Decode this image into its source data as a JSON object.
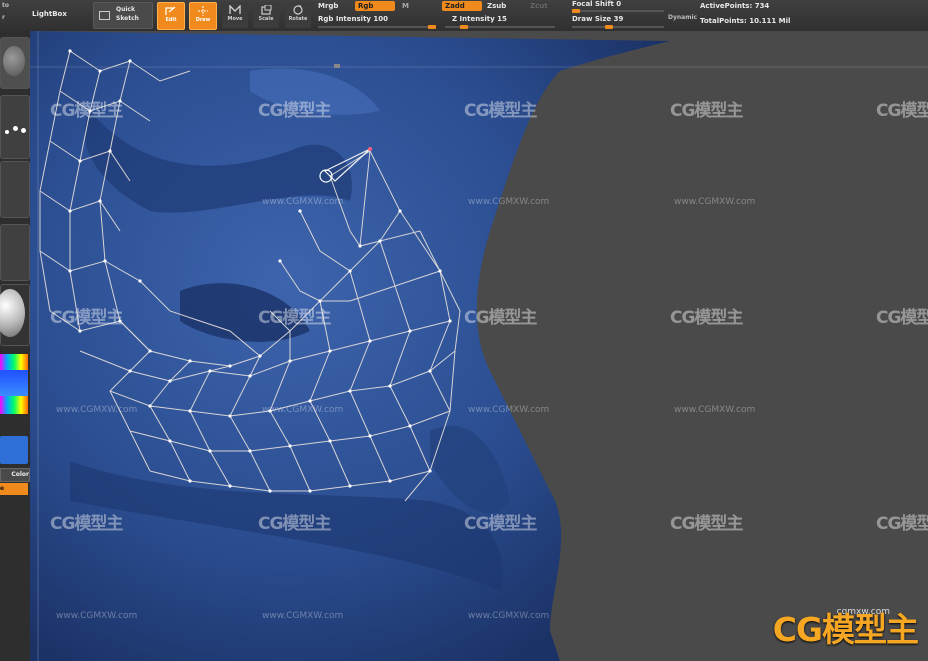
{
  "toolbar": {
    "lightbox": "LightBox",
    "quick_sketch": [
      "Quick",
      "Sketch"
    ],
    "modes": [
      {
        "label": "Edit",
        "icon": "edit-icon",
        "active": true
      },
      {
        "label": "Draw",
        "icon": "draw-icon",
        "active": true
      },
      {
        "label": "Move",
        "icon": "move-icon",
        "active": false
      },
      {
        "label": "Scale",
        "icon": "scale-icon",
        "active": false
      },
      {
        "label": "Rotate",
        "icon": "rotate-icon",
        "active": false
      }
    ],
    "mrgb": "Mrgb",
    "rgb": "Rgb",
    "m": "M",
    "rgb_intensity": "Rgb Intensity 100",
    "zadd": "Zadd",
    "zsub": "Zsub",
    "zcut": "Zcut",
    "z_intensity": "Z Intensity 15",
    "focal_shift": "Focal Shift 0",
    "draw_size": "Draw Size 39",
    "dynamic": "Dynamic",
    "active_points": "ActivePoints: 734",
    "total_points": "TotalPoints: 10.111 Mil",
    "slider_rgb_intensity": 1.0,
    "slider_z_intensity": 0.15,
    "slider_focal_shift": 0.0,
    "slider_draw_size": 0.39
  },
  "left_panel": {
    "labels": [
      "Color",
      "e"
    ]
  },
  "watermark": {
    "text": "CG模型主",
    "url": "www.CGMXW.com"
  },
  "logo": {
    "text": "CG模型主",
    "url": "cgmxw.com"
  },
  "colors": {
    "accent": "#f08a1c",
    "mesh": "#2f4f8f",
    "background": "#4a4a4a"
  }
}
